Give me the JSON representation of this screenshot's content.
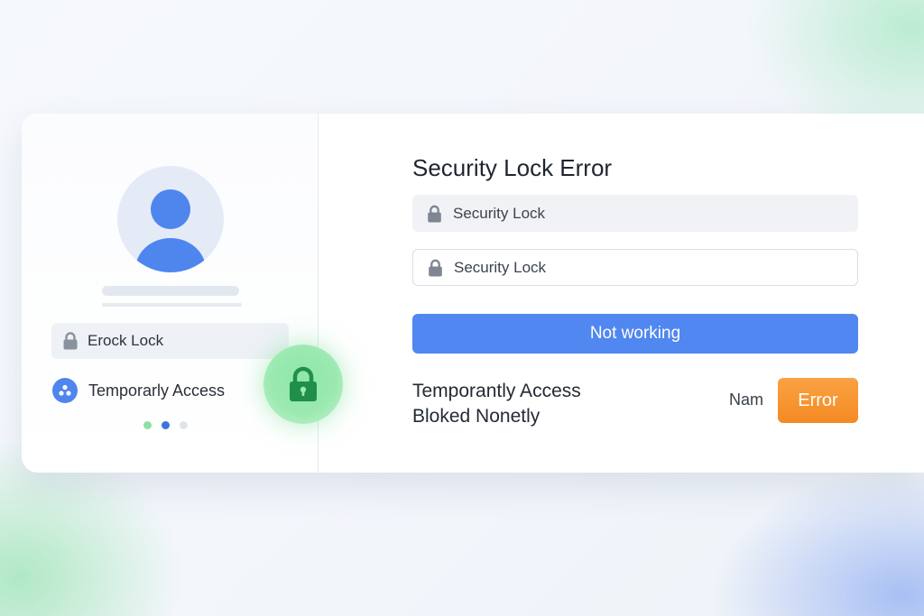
{
  "left_panel": {
    "lock_field_label": "Erock Lock",
    "access_label": "Temporarly Access",
    "pagination": {
      "count": 3,
      "active_index": 1,
      "colors": [
        "#8fe0a4",
        "#3f72e0",
        "#dfe3ea"
      ]
    },
    "badge_icon": "padlock-icon"
  },
  "main": {
    "title": "Security Lock Error",
    "field1": {
      "value": "Security Lock",
      "icon": "lock-icon"
    },
    "field2": {
      "value": "Security Lock",
      "icon": "lock-icon"
    },
    "primary_button": "Not working",
    "message_line1": "Temporantly Access",
    "message_line2": "Bloked Nonetly",
    "side_label": "Nam",
    "error_button": "Error"
  },
  "colors": {
    "primary": "#5087f0",
    "error": "#f48a22",
    "success": "#1f8f4a",
    "avatar": "#4e86ee"
  }
}
